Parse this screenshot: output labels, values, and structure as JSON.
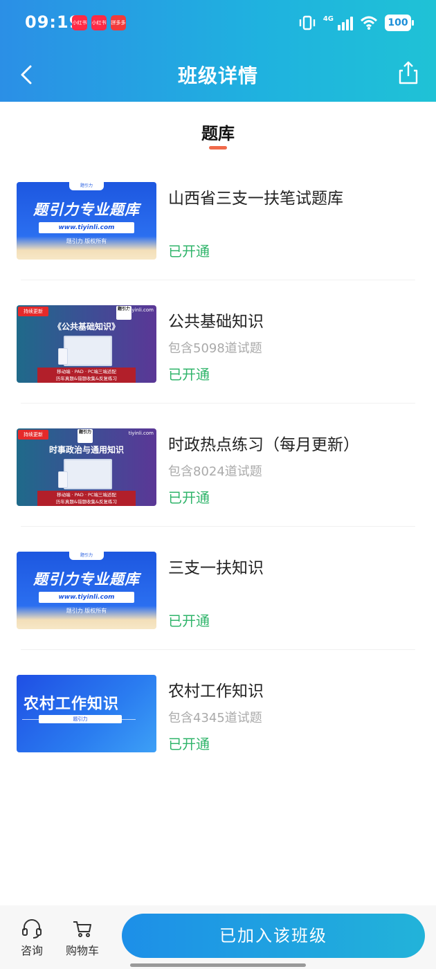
{
  "status_bar": {
    "time": "09:19",
    "app_badges": [
      "小红书",
      "小红书",
      "拼多多"
    ],
    "network": "4G",
    "battery": "100"
  },
  "header": {
    "title": "班级详情"
  },
  "tab": {
    "label": "题库"
  },
  "items": [
    {
      "title": "山西省三支一扶笔试题库",
      "count": "",
      "status": "已开通",
      "thumb": {
        "type": "blue",
        "main": "题引力专业题库",
        "url": "www.tiyinli.com",
        "sub": "题引力 版权所有",
        "logo": "题引力"
      }
    },
    {
      "title": "公共基础知识",
      "count": "包含5098道试题",
      "status": "已开通",
      "thumb": {
        "type": "purple",
        "tag": "持续更新",
        "brand": "tiyinli.com",
        "logo": "题引力",
        "main": "《公共基础知识》",
        "band1": "移动端 · PAD · PC端三端适配",
        "band2": "历年真题&错题收集&反复练习"
      }
    },
    {
      "title": "时政热点练习（每月更新）",
      "count": "包含8024道试题",
      "status": "已开通",
      "thumb": {
        "type": "purple",
        "tag": "持续更新",
        "brand": "tiyinli.com",
        "logo": "题引力",
        "main": "时事政治与通用知识",
        "band1": "移动端 · PAD · PC端三端适配",
        "band2": "历年真题&错题收集&反复练习"
      }
    },
    {
      "title": "三支一扶知识",
      "count": "",
      "status": "已开通",
      "thumb": {
        "type": "blue",
        "main": "题引力专业题库",
        "url": "www.tiyinli.com",
        "sub": "题引力 版权所有",
        "logo": "题引力"
      }
    },
    {
      "title": "农村工作知识",
      "count": "包含4345道试题",
      "status": "已开通",
      "thumb": {
        "type": "rural",
        "main": "农村工作知识",
        "bar": "题引力"
      }
    }
  ],
  "bottom_bar": {
    "consult_label": "咨询",
    "cart_label": "购物车",
    "join_label": "已加入该班级"
  },
  "colors": {
    "header_start": "#2b8fe6",
    "header_end": "#1fc2d6",
    "status_green": "#2fb46a",
    "tab_indicator": "#f06a4a"
  }
}
